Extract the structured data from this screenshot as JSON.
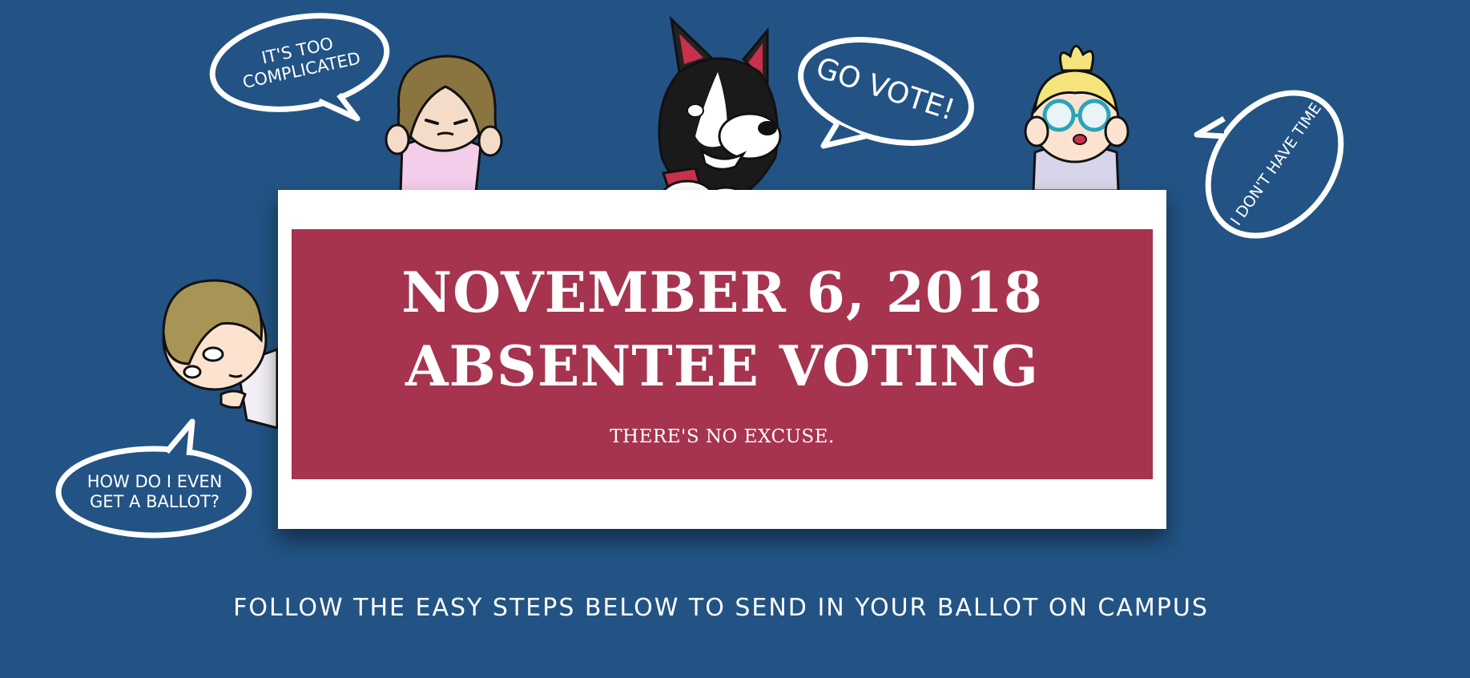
{
  "bubbles": {
    "complicated": [
      "IT'S TOO",
      "COMPLICATED"
    ],
    "go_vote": "GO VOTE!",
    "no_time": "I DON'T HAVE TIME",
    "ballot": [
      "HOW DO I EVEN",
      "GET A BALLOT?"
    ]
  },
  "banner": {
    "date": "NOVEMBER 6, 2018",
    "title": "ABSENTEE VOTING",
    "tagline": "THERE'S NO EXCUSE."
  },
  "instructions": "FOLLOW THE EASY STEPS BELOW TO SEND IN YOUR BALLOT ON CAMPUS",
  "colors": {
    "background": "#225384",
    "banner": "#a6344f",
    "card": "#ffffff"
  }
}
